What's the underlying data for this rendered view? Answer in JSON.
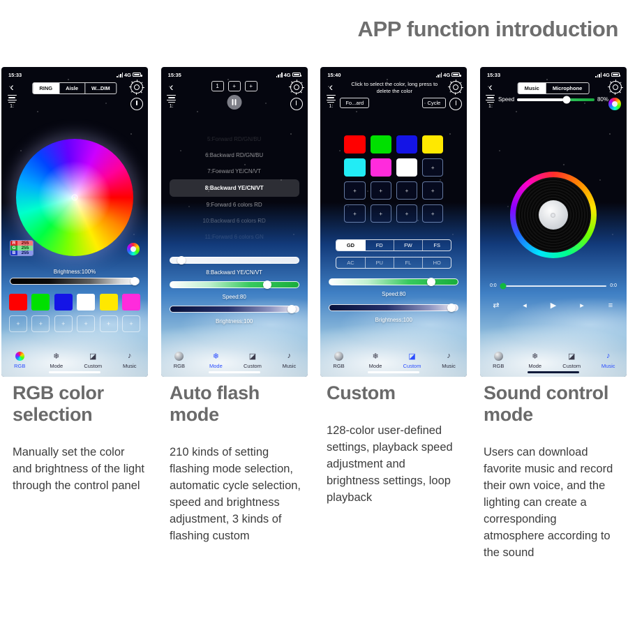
{
  "title": "APP function introduction",
  "phones": [
    {
      "status": {
        "time": "15:33",
        "network": "4G"
      },
      "rail": {
        "number": "1:"
      },
      "segments": [
        {
          "label": "RING",
          "active": true
        },
        {
          "label": "Aisle",
          "active": false
        },
        {
          "label": "W...DIM",
          "active": false
        }
      ],
      "rgb": {
        "r_label": "R",
        "r_value": "255",
        "g_label": "G",
        "g_value": "255",
        "b_label": "B",
        "b_value": "255"
      },
      "brightness_label": "Brightness:100%",
      "swatches": [
        "#ff0000",
        "#00e000",
        "#1414e6",
        "#ffffff",
        "#ffe800",
        "#ff2bdc"
      ],
      "add_symbol": "+",
      "nav": [
        {
          "label": "RGB",
          "icon": "color-wheel-icon",
          "active": true
        },
        {
          "label": "Mode",
          "icon": "snowflake-icon",
          "active": false
        },
        {
          "label": "Custom",
          "icon": "pencil-circle-icon",
          "active": false
        },
        {
          "label": "Music",
          "icon": "music-note-icon",
          "active": false
        }
      ]
    },
    {
      "status": {
        "time": "15:35",
        "network": "4G"
      },
      "rail": {
        "number": "1:"
      },
      "top_buttons": [
        "1",
        "+",
        "+"
      ],
      "modes": [
        "5:Forward RD/GN/BU",
        "6:Backward RD/GN/BU",
        "7:Foeward YE/CN/VT",
        "8:Backward YE/CN/VT",
        "9:Forward 6 colors RD",
        "10:Backward 6 colors RD",
        "11:Forward 6 colors GN"
      ],
      "selected_mode_index": 3,
      "mode_label": "8:Backward YE/CN/VT",
      "speed_label": "Speed:80",
      "brightness_label": "Brightness:100",
      "nav": [
        {
          "label": "RGB",
          "icon": "color-wheel-icon",
          "active": false
        },
        {
          "label": "Mode",
          "icon": "snowflake-icon",
          "active": true
        },
        {
          "label": "Custom",
          "icon": "pencil-circle-icon",
          "active": false
        },
        {
          "label": "Music",
          "icon": "music-note-icon",
          "active": false
        }
      ]
    },
    {
      "status": {
        "time": "15:40",
        "network": "4G"
      },
      "rail": {
        "number": "1:"
      },
      "hint": "Click to select the color, long press to delete the color",
      "left_button": "Fo...ard",
      "right_button": "Cycle",
      "grid": [
        "#ff0000",
        "#00e000",
        "#1414e6",
        "#ffe800",
        "#22ecf5",
        "#ff2bdc",
        "#ffffff",
        "",
        "",
        "",
        "",
        "",
        "",
        "",
        "",
        ""
      ],
      "add_symbol": "+",
      "tabs_row1": [
        {
          "label": "GD",
          "active": true
        },
        {
          "label": "FD",
          "active": false
        },
        {
          "label": "FW",
          "active": false
        },
        {
          "label": "FS",
          "active": false
        }
      ],
      "tabs_row2": [
        {
          "label": "AC",
          "active": false
        },
        {
          "label": "PU",
          "active": false
        },
        {
          "label": "FL",
          "active": false
        },
        {
          "label": "HO",
          "active": false
        }
      ],
      "speed_label": "Speed:80",
      "brightness_label": "Brightness:100",
      "nav": [
        {
          "label": "RGB",
          "icon": "color-wheel-icon",
          "active": false
        },
        {
          "label": "Mode",
          "icon": "snowflake-icon",
          "active": false
        },
        {
          "label": "Custom",
          "icon": "pencil-circle-icon",
          "active": true
        },
        {
          "label": "Music",
          "icon": "music-note-icon",
          "active": false
        }
      ]
    },
    {
      "status": {
        "time": "15:33",
        "network": "4G"
      },
      "rail": {
        "number": "1:"
      },
      "segments": [
        {
          "label": "Music",
          "active": true
        },
        {
          "label": "Microphone",
          "active": false
        }
      ],
      "speed_label": "Speed",
      "speed_percent": "80%",
      "time_start": "0:0",
      "time_end": "0:0",
      "transport": [
        "shuffle-icon",
        "previous-icon",
        "play-icon",
        "next-icon",
        "playlist-icon"
      ],
      "nav": [
        {
          "label": "RGB",
          "icon": "color-wheel-icon",
          "active": false
        },
        {
          "label": "Mode",
          "icon": "snowflake-icon",
          "active": false
        },
        {
          "label": "Custom",
          "icon": "pencil-circle-icon",
          "active": false
        },
        {
          "label": "Music",
          "icon": "music-note-icon",
          "active": true
        }
      ]
    }
  ],
  "captions": [
    {
      "heading": "RGB color selection",
      "body": "Manually set the color and brightness of the light through the control panel"
    },
    {
      "heading": "Auto flash mode",
      "body": "210 kinds of setting flashing mode selection, automatic cycle selection, speed and brightness adjustment, 3 kinds of flashing custom"
    },
    {
      "heading": "Custom",
      "body": "128-color user-defined settings, playback speed adjustment and brightness settings, loop playback"
    },
    {
      "heading": "Sound control mode",
      "body": "Users can download favorite music and record their own voice, and the lighting can create a corresponding atmosphere according to the sound"
    }
  ],
  "colors": {
    "title_gray": "#6e6e6e",
    "accent_blue": "#2b4dff",
    "body_gray": "#3c3c3c"
  }
}
